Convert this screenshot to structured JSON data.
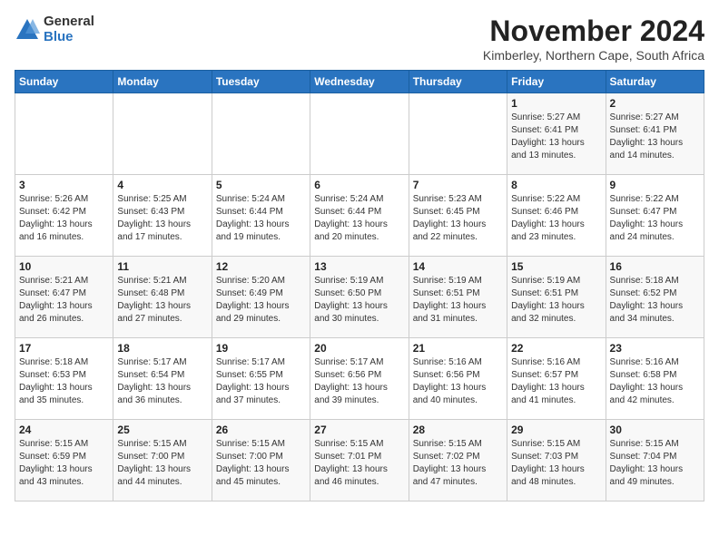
{
  "logo": {
    "general": "General",
    "blue": "Blue"
  },
  "title": "November 2024",
  "subtitle": "Kimberley, Northern Cape, South Africa",
  "headers": [
    "Sunday",
    "Monday",
    "Tuesday",
    "Wednesday",
    "Thursday",
    "Friday",
    "Saturday"
  ],
  "weeks": [
    [
      {
        "day": "",
        "info": ""
      },
      {
        "day": "",
        "info": ""
      },
      {
        "day": "",
        "info": ""
      },
      {
        "day": "",
        "info": ""
      },
      {
        "day": "",
        "info": ""
      },
      {
        "day": "1",
        "info": "Sunrise: 5:27 AM\nSunset: 6:41 PM\nDaylight: 13 hours\nand 13 minutes."
      },
      {
        "day": "2",
        "info": "Sunrise: 5:27 AM\nSunset: 6:41 PM\nDaylight: 13 hours\nand 14 minutes."
      }
    ],
    [
      {
        "day": "3",
        "info": "Sunrise: 5:26 AM\nSunset: 6:42 PM\nDaylight: 13 hours\nand 16 minutes."
      },
      {
        "day": "4",
        "info": "Sunrise: 5:25 AM\nSunset: 6:43 PM\nDaylight: 13 hours\nand 17 minutes."
      },
      {
        "day": "5",
        "info": "Sunrise: 5:24 AM\nSunset: 6:44 PM\nDaylight: 13 hours\nand 19 minutes."
      },
      {
        "day": "6",
        "info": "Sunrise: 5:24 AM\nSunset: 6:44 PM\nDaylight: 13 hours\nand 20 minutes."
      },
      {
        "day": "7",
        "info": "Sunrise: 5:23 AM\nSunset: 6:45 PM\nDaylight: 13 hours\nand 22 minutes."
      },
      {
        "day": "8",
        "info": "Sunrise: 5:22 AM\nSunset: 6:46 PM\nDaylight: 13 hours\nand 23 minutes."
      },
      {
        "day": "9",
        "info": "Sunrise: 5:22 AM\nSunset: 6:47 PM\nDaylight: 13 hours\nand 24 minutes."
      }
    ],
    [
      {
        "day": "10",
        "info": "Sunrise: 5:21 AM\nSunset: 6:47 PM\nDaylight: 13 hours\nand 26 minutes."
      },
      {
        "day": "11",
        "info": "Sunrise: 5:21 AM\nSunset: 6:48 PM\nDaylight: 13 hours\nand 27 minutes."
      },
      {
        "day": "12",
        "info": "Sunrise: 5:20 AM\nSunset: 6:49 PM\nDaylight: 13 hours\nand 29 minutes."
      },
      {
        "day": "13",
        "info": "Sunrise: 5:19 AM\nSunset: 6:50 PM\nDaylight: 13 hours\nand 30 minutes."
      },
      {
        "day": "14",
        "info": "Sunrise: 5:19 AM\nSunset: 6:51 PM\nDaylight: 13 hours\nand 31 minutes."
      },
      {
        "day": "15",
        "info": "Sunrise: 5:19 AM\nSunset: 6:51 PM\nDaylight: 13 hours\nand 32 minutes."
      },
      {
        "day": "16",
        "info": "Sunrise: 5:18 AM\nSunset: 6:52 PM\nDaylight: 13 hours\nand 34 minutes."
      }
    ],
    [
      {
        "day": "17",
        "info": "Sunrise: 5:18 AM\nSunset: 6:53 PM\nDaylight: 13 hours\nand 35 minutes."
      },
      {
        "day": "18",
        "info": "Sunrise: 5:17 AM\nSunset: 6:54 PM\nDaylight: 13 hours\nand 36 minutes."
      },
      {
        "day": "19",
        "info": "Sunrise: 5:17 AM\nSunset: 6:55 PM\nDaylight: 13 hours\nand 37 minutes."
      },
      {
        "day": "20",
        "info": "Sunrise: 5:17 AM\nSunset: 6:56 PM\nDaylight: 13 hours\nand 39 minutes."
      },
      {
        "day": "21",
        "info": "Sunrise: 5:16 AM\nSunset: 6:56 PM\nDaylight: 13 hours\nand 40 minutes."
      },
      {
        "day": "22",
        "info": "Sunrise: 5:16 AM\nSunset: 6:57 PM\nDaylight: 13 hours\nand 41 minutes."
      },
      {
        "day": "23",
        "info": "Sunrise: 5:16 AM\nSunset: 6:58 PM\nDaylight: 13 hours\nand 42 minutes."
      }
    ],
    [
      {
        "day": "24",
        "info": "Sunrise: 5:15 AM\nSunset: 6:59 PM\nDaylight: 13 hours\nand 43 minutes."
      },
      {
        "day": "25",
        "info": "Sunrise: 5:15 AM\nSunset: 7:00 PM\nDaylight: 13 hours\nand 44 minutes."
      },
      {
        "day": "26",
        "info": "Sunrise: 5:15 AM\nSunset: 7:00 PM\nDaylight: 13 hours\nand 45 minutes."
      },
      {
        "day": "27",
        "info": "Sunrise: 5:15 AM\nSunset: 7:01 PM\nDaylight: 13 hours\nand 46 minutes."
      },
      {
        "day": "28",
        "info": "Sunrise: 5:15 AM\nSunset: 7:02 PM\nDaylight: 13 hours\nand 47 minutes."
      },
      {
        "day": "29",
        "info": "Sunrise: 5:15 AM\nSunset: 7:03 PM\nDaylight: 13 hours\nand 48 minutes."
      },
      {
        "day": "30",
        "info": "Sunrise: 5:15 AM\nSunset: 7:04 PM\nDaylight: 13 hours\nand 49 minutes."
      }
    ]
  ]
}
